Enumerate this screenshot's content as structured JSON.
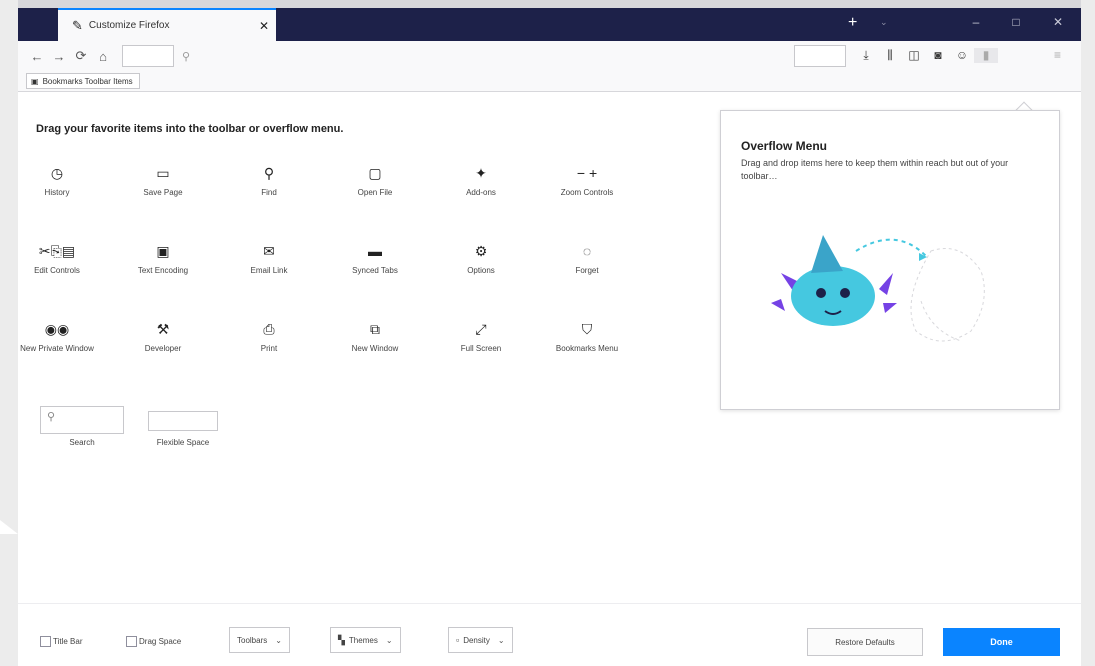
{
  "tab": {
    "title": "Customize Firefox",
    "icon": "paintbrush-icon",
    "close": "✕"
  },
  "window_controls": {
    "new_tab": "+",
    "tab_list": "⌄",
    "minimize": "–",
    "maximize": "□",
    "close": "✕"
  },
  "navbar": {
    "back": "←",
    "forward": "→",
    "reload": "⟳",
    "home": "⌂",
    "search_glyph": "⚲",
    "icons": [
      {
        "name": "downloads-icon",
        "glyph": "⤓"
      },
      {
        "name": "library-icon",
        "glyph": "⫼"
      },
      {
        "name": "sidebars-icon",
        "glyph": "◫"
      },
      {
        "name": "screenshots-icon",
        "glyph": "◙"
      },
      {
        "name": "account-icon",
        "glyph": "☺"
      },
      {
        "name": "extensions-placeholder-icon",
        "glyph": "▮"
      }
    ],
    "overflow": "≡"
  },
  "bookmarks_toolbar": {
    "label": "Bookmarks Toolbar Items",
    "icon": "▣"
  },
  "palette": {
    "heading": "Drag your favorite items into the toolbar or overflow menu.",
    "items": [
      {
        "label": "History",
        "glyph": "◷"
      },
      {
        "label": "Save Page",
        "glyph": "▭"
      },
      {
        "label": "Find",
        "glyph": "⚲"
      },
      {
        "label": "Open File",
        "glyph": "▢"
      },
      {
        "label": "Add-ons",
        "glyph": "✦"
      },
      {
        "label": "Zoom Controls",
        "glyph": "− +"
      },
      {
        "label": "Edit Controls",
        "glyph": "✂⎘▤"
      },
      {
        "label": "Text Encoding",
        "glyph": "▣"
      },
      {
        "label": "Email Link",
        "glyph": "✉"
      },
      {
        "label": "Synced Tabs",
        "glyph": "▬"
      },
      {
        "label": "Options",
        "glyph": "⚙"
      },
      {
        "label": "Forget",
        "glyph": "◌"
      },
      {
        "label": "New Private Window",
        "glyph": "◉◉"
      },
      {
        "label": "Developer",
        "glyph": "⚒"
      },
      {
        "label": "Print",
        "glyph": "⎙"
      },
      {
        "label": "New Window",
        "glyph": "⧉"
      },
      {
        "label": "Full Screen",
        "glyph": "⤢"
      },
      {
        "label": "Bookmarks Menu",
        "glyph": "⛉"
      }
    ],
    "search_label": "Search",
    "search_glyph": "⚲",
    "flexible_space_label": "Flexible Space"
  },
  "overflow_menu": {
    "title": "Overflow Menu",
    "description": "Drag and drop items here to keep them within reach but out of your toolbar…"
  },
  "footer": {
    "title_bar": "Title Bar",
    "drag_space": "Drag Space",
    "toolbars": "Toolbars",
    "themes": "Themes",
    "density": "Density",
    "chevron": "⌄",
    "restore_defaults": "Restore Defaults",
    "done": "Done"
  },
  "colors": {
    "tabstrip": "#1d2149",
    "accent": "#0a84ff"
  }
}
